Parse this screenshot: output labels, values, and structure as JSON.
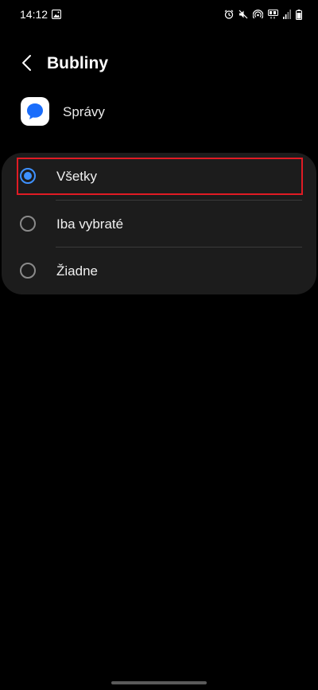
{
  "status_bar": {
    "time": "14:12",
    "left_icon": "image-icon",
    "right_icons": [
      "alarm-icon",
      "mute-icon",
      "hotspot-icon",
      "data-icon",
      "signal-icon",
      "battery-icon"
    ]
  },
  "header": {
    "back_icon": "back-arrow-icon",
    "title": "Bubliny"
  },
  "app": {
    "icon": "messages-app-icon",
    "name": "Správy",
    "icon_color": "#1a6dfb"
  },
  "options": [
    {
      "label": "Všetky",
      "selected": true
    },
    {
      "label": "Iba vybraté",
      "selected": false
    },
    {
      "label": "Žiadne",
      "selected": false
    }
  ],
  "colors": {
    "accent": "#3e91ff",
    "highlight": "#e01b24",
    "card_background": "#1c1c1c"
  }
}
